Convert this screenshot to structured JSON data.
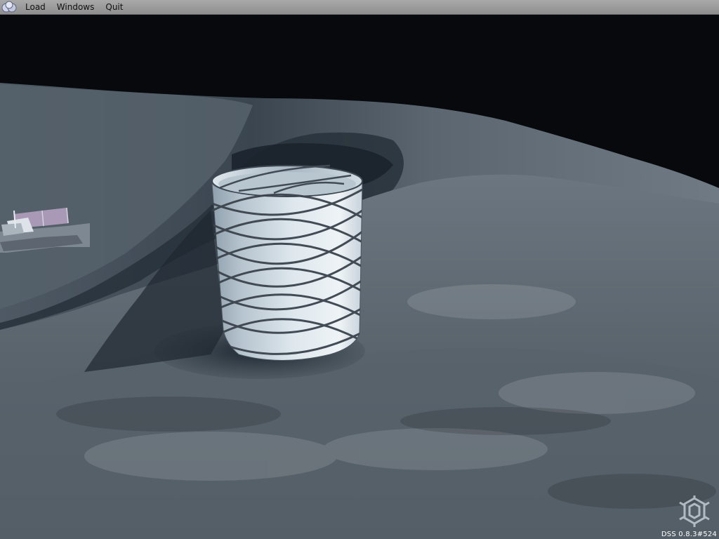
{
  "menubar": {
    "app_icon": "app-logo-icon",
    "items": [
      {
        "label": "Load"
      },
      {
        "label": "Windows"
      },
      {
        "label": "Quit"
      }
    ]
  },
  "scene": {
    "sky_color": "#07090c",
    "terrain_color": "#5d6770",
    "shadow_color": "#1f2730",
    "objects": [
      "cylindrical-habitat",
      "lander-module"
    ]
  },
  "overlay": {
    "version_text": "DSS 0.8.3#524",
    "engine_logo_icon": "gear-logo-icon"
  }
}
